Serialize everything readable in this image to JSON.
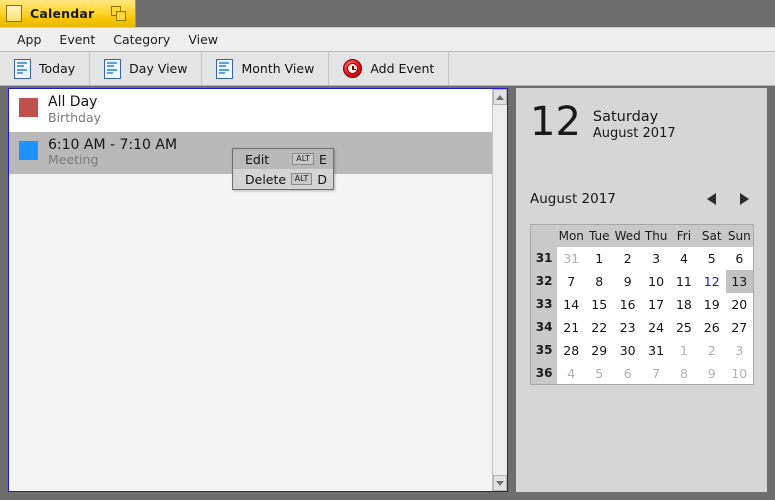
{
  "window": {
    "title": "Calendar",
    "doc_icon": "document-icon",
    "restore_icon": "restore-windows-icon"
  },
  "menubar": {
    "items": [
      {
        "label": "App"
      },
      {
        "label": "Event"
      },
      {
        "label": "Category"
      },
      {
        "label": "View"
      }
    ]
  },
  "toolbar": {
    "buttons": [
      {
        "label": "Today",
        "icon": "document-icon"
      },
      {
        "label": "Day View",
        "icon": "document-icon"
      },
      {
        "label": "Month View",
        "icon": "document-icon"
      },
      {
        "label": "Add Event",
        "icon": "red-clock-icon"
      }
    ]
  },
  "event_list": {
    "events": [
      {
        "time": "All Day",
        "category": "Birthday",
        "color": "#c0504d",
        "selected": false
      },
      {
        "time": "6:10 AM - 7:10 AM",
        "category": "Meeting",
        "color": "#1e90ff",
        "selected": true
      }
    ],
    "scrollbar": {
      "up_icon": "scroll-up-arrow-icon",
      "down_icon": "scroll-down-arrow-icon"
    }
  },
  "context_menu": {
    "items": [
      {
        "label": "Edit",
        "modifier": "ALT",
        "key": "E",
        "hovered": true
      },
      {
        "label": "Delete",
        "modifier": "ALT",
        "key": "D",
        "hovered": false
      }
    ]
  },
  "detail_panel": {
    "day_number": "12",
    "weekday": "Saturday",
    "month_year": "August 2017",
    "mini_calendar": {
      "month_label": "August 2017",
      "prev_icon": "left-arrow-icon",
      "next_icon": "right-arrow-icon",
      "weekday_headers": [
        "Mon",
        "Tue",
        "Wed",
        "Thu",
        "Fri",
        "Sat",
        "Sun"
      ],
      "week_numbers": [
        "31",
        "32",
        "33",
        "34",
        "35",
        "36"
      ],
      "weeks": [
        [
          {
            "n": "31",
            "adj": true,
            "today": false,
            "selected": false
          },
          {
            "n": "1",
            "adj": false,
            "today": false,
            "selected": false
          },
          {
            "n": "2",
            "adj": false,
            "today": false,
            "selected": false
          },
          {
            "n": "3",
            "adj": false,
            "today": false,
            "selected": false
          },
          {
            "n": "4",
            "adj": false,
            "today": false,
            "selected": false
          },
          {
            "n": "5",
            "adj": false,
            "today": false,
            "selected": false
          },
          {
            "n": "6",
            "adj": false,
            "today": false,
            "selected": false
          }
        ],
        [
          {
            "n": "7",
            "adj": false,
            "today": false,
            "selected": false
          },
          {
            "n": "8",
            "adj": false,
            "today": false,
            "selected": false
          },
          {
            "n": "9",
            "adj": false,
            "today": false,
            "selected": false
          },
          {
            "n": "10",
            "adj": false,
            "today": false,
            "selected": false
          },
          {
            "n": "11",
            "adj": false,
            "today": false,
            "selected": false
          },
          {
            "n": "12",
            "adj": false,
            "today": true,
            "selected": false
          },
          {
            "n": "13",
            "adj": false,
            "today": false,
            "selected": true
          }
        ],
        [
          {
            "n": "14",
            "adj": false,
            "today": false,
            "selected": false
          },
          {
            "n": "15",
            "adj": false,
            "today": false,
            "selected": false
          },
          {
            "n": "16",
            "adj": false,
            "today": false,
            "selected": false
          },
          {
            "n": "17",
            "adj": false,
            "today": false,
            "selected": false
          },
          {
            "n": "18",
            "adj": false,
            "today": false,
            "selected": false
          },
          {
            "n": "19",
            "adj": false,
            "today": false,
            "selected": false
          },
          {
            "n": "20",
            "adj": false,
            "today": false,
            "selected": false
          }
        ],
        [
          {
            "n": "21",
            "adj": false,
            "today": false,
            "selected": false
          },
          {
            "n": "22",
            "adj": false,
            "today": false,
            "selected": false
          },
          {
            "n": "23",
            "adj": false,
            "today": false,
            "selected": false
          },
          {
            "n": "24",
            "adj": false,
            "today": false,
            "selected": false
          },
          {
            "n": "25",
            "adj": false,
            "today": false,
            "selected": false
          },
          {
            "n": "26",
            "adj": false,
            "today": false,
            "selected": false
          },
          {
            "n": "27",
            "adj": false,
            "today": false,
            "selected": false
          }
        ],
        [
          {
            "n": "28",
            "adj": false,
            "today": false,
            "selected": false
          },
          {
            "n": "29",
            "adj": false,
            "today": false,
            "selected": false
          },
          {
            "n": "30",
            "adj": false,
            "today": false,
            "selected": false
          },
          {
            "n": "31",
            "adj": false,
            "today": false,
            "selected": false
          },
          {
            "n": "1",
            "adj": true,
            "today": false,
            "selected": false
          },
          {
            "n": "2",
            "adj": true,
            "today": false,
            "selected": false
          },
          {
            "n": "3",
            "adj": true,
            "today": false,
            "selected": false
          }
        ],
        [
          {
            "n": "4",
            "adj": true,
            "today": false,
            "selected": false
          },
          {
            "n": "5",
            "adj": true,
            "today": false,
            "selected": false
          },
          {
            "n": "6",
            "adj": true,
            "today": false,
            "selected": false
          },
          {
            "n": "7",
            "adj": true,
            "today": false,
            "selected": false
          },
          {
            "n": "8",
            "adj": true,
            "today": false,
            "selected": false
          },
          {
            "n": "9",
            "adj": true,
            "today": false,
            "selected": false
          },
          {
            "n": "10",
            "adj": true,
            "today": false,
            "selected": false
          }
        ]
      ]
    }
  }
}
